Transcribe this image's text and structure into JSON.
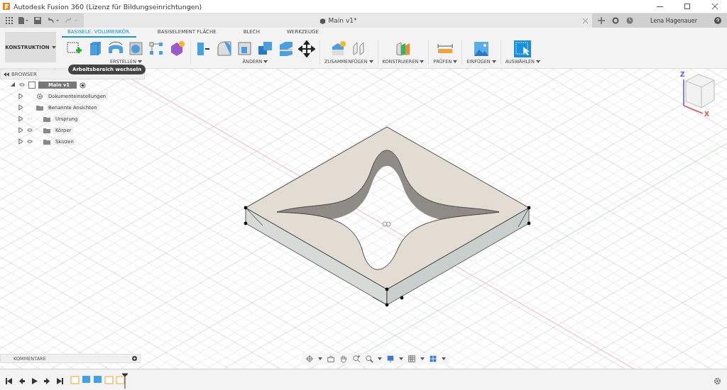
{
  "window": {
    "title": "Autodesk Fusion 360 (Lizenz für Bildungseinrichtungen)"
  },
  "document_tab": {
    "title": "Main v1*"
  },
  "user": {
    "name": "Lena Hagenauer"
  },
  "workspace": {
    "label": "KONSTRUKTION"
  },
  "tabs": [
    {
      "label": "BASISELE. VOLUMENKÖR.",
      "selected": true
    },
    {
      "label": "BASISELEMENT FLÄCHE",
      "selected": false
    },
    {
      "label": "BLECH",
      "selected": false
    },
    {
      "label": "WERKZEUGE",
      "selected": false
    }
  ],
  "groups": [
    {
      "label": "ERSTELLEN"
    },
    {
      "label": "ÄNDERN"
    },
    {
      "label": "ZUSAMMENFÜGEN"
    },
    {
      "label": "KONSTRUIEREN"
    },
    {
      "label": "PRÜFEN"
    },
    {
      "label": "EINFÜGEN"
    },
    {
      "label": "AUSWÄHLEN"
    }
  ],
  "tooltip": {
    "text": "Arbeitsbereich wechseln"
  },
  "browser": {
    "title": "BROWSER",
    "tree": [
      {
        "label": "Main v1",
        "kind": "component",
        "expanded": true,
        "selected": true,
        "visible": true,
        "children": [
          {
            "label": "Dokumenteinstellungen",
            "kind": "settings",
            "expanded": false
          },
          {
            "label": "Benannte Ansichten",
            "kind": "folder",
            "expanded": false
          },
          {
            "label": "Ursprung",
            "kind": "layer",
            "expanded": false,
            "visible": false
          },
          {
            "label": "Körper",
            "kind": "layer",
            "expanded": false,
            "visible": true
          },
          {
            "label": "Skizzen",
            "kind": "layer",
            "expanded": false,
            "visible": true
          }
        ]
      }
    ]
  },
  "viewcube": {
    "axes": [
      {
        "label": "Z",
        "color": "#5b5bd6"
      },
      {
        "label": "X",
        "color": "#d9534f"
      }
    ]
  },
  "comments": {
    "title": "KOMMENTARE"
  }
}
